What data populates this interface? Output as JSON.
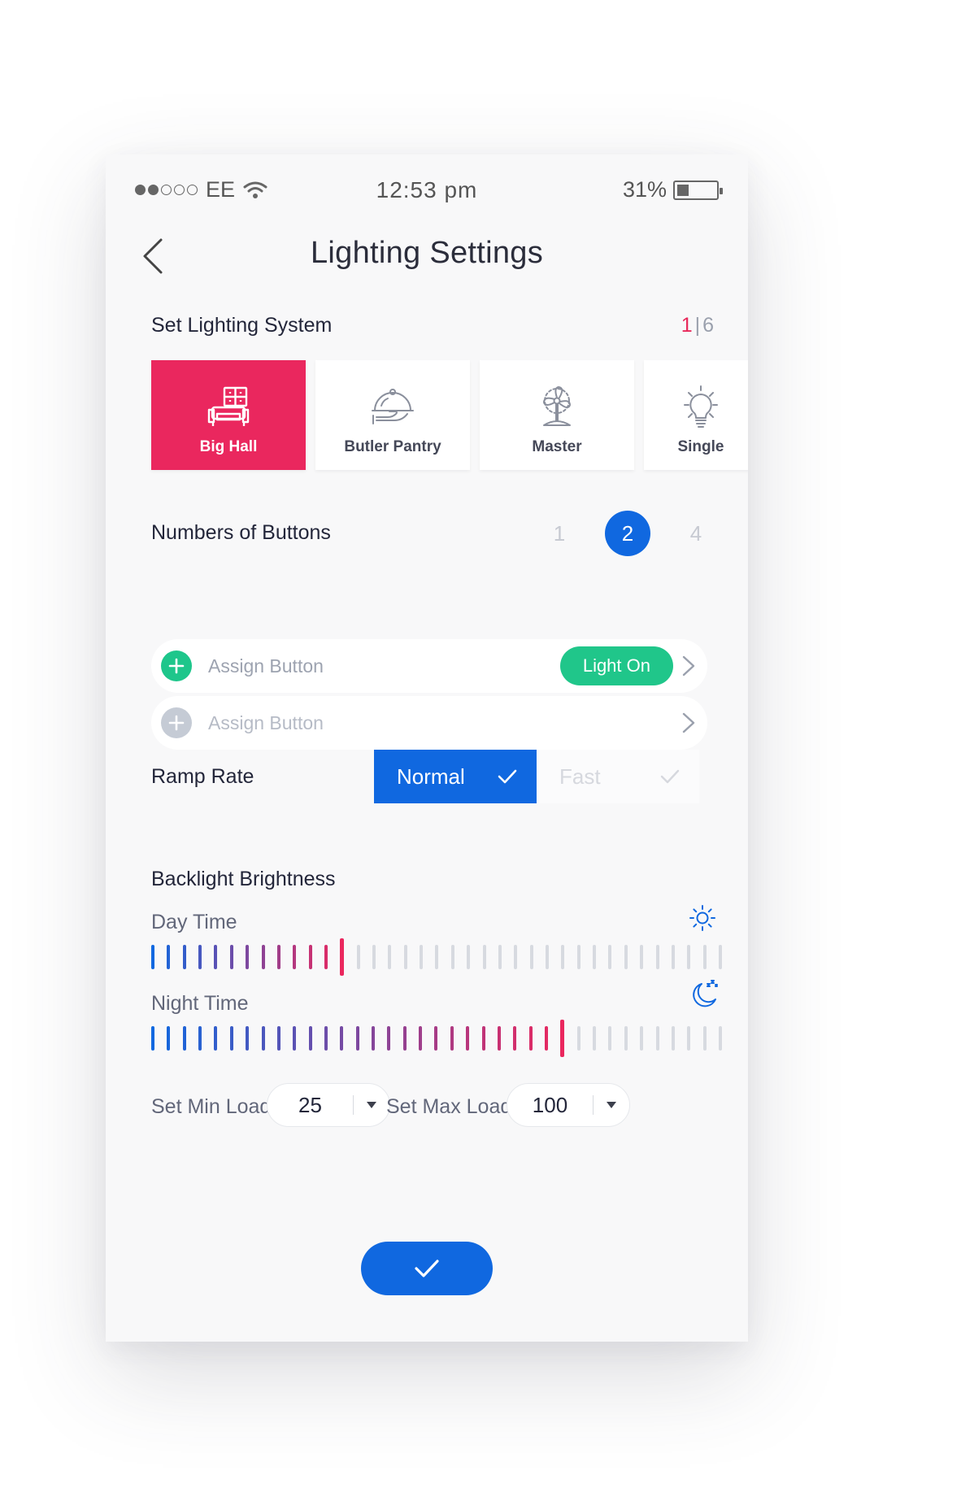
{
  "status_bar": {
    "carrier": "EE",
    "time": "12:53 pm",
    "battery": "31%",
    "battery_level": 0.31,
    "signal_bars_filled": 2,
    "signal_bars_total": 5
  },
  "header": {
    "title": "Lighting Settings",
    "back_icon": "chevron-left-icon"
  },
  "lighting_system": {
    "label": "Set Lighting System",
    "pager_current": "1",
    "pager_sep": "|",
    "pager_total": "6",
    "cards": [
      {
        "label": "Big Hall",
        "icon": "sofa-icon",
        "active": true
      },
      {
        "label": "Butler Pantry",
        "icon": "cloche-icon",
        "active": false
      },
      {
        "label": "Master",
        "icon": "fan-icon",
        "active": false
      },
      {
        "label": "Single",
        "icon": "bulb-icon",
        "active": false
      }
    ]
  },
  "buttons_count": {
    "label": "Numbers of Buttons",
    "options": [
      "1",
      "2",
      "4"
    ],
    "selected": "2"
  },
  "assign_rows": [
    {
      "label": "Assign Button",
      "action": "Light On",
      "active": true
    },
    {
      "label": "Assign Button",
      "action": "",
      "active": false
    }
  ],
  "ramp_rate": {
    "label": "Ramp Rate",
    "options": [
      "Normal",
      "Fast"
    ],
    "selected": "Normal"
  },
  "backlight": {
    "label": "Backlight  Brightness",
    "day": {
      "label": "Day Time",
      "icon": "sun-icon",
      "level": 12,
      "steps": 37
    },
    "night": {
      "label": "Night Time",
      "icon": "moon-icon",
      "level": 26,
      "steps": 37
    }
  },
  "load": {
    "min_label": "Set Min Load",
    "min_value": "25",
    "max_label": "Set Max Load",
    "max_value": "100"
  },
  "confirm": {
    "icon": "check-icon"
  },
  "colors": {
    "accent_pink": "#ea275e",
    "accent_blue": "#1068e0",
    "accent_green": "#1ec68b"
  }
}
